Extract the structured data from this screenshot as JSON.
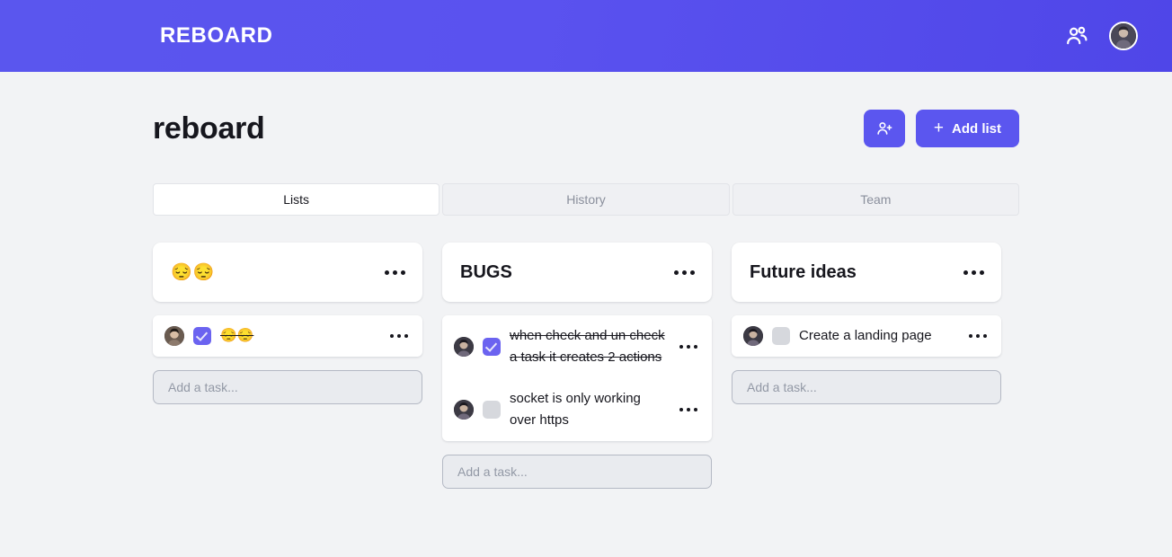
{
  "topbar": {
    "brand": "REBOARD",
    "people_icon": "people-icon",
    "avatar": "user-avatar"
  },
  "header": {
    "board_title": "reboard",
    "invite_button_icon": "person-add-icon",
    "add_list_label": "Add list",
    "add_list_plus": "+"
  },
  "tabs": [
    {
      "label": "Lists",
      "active": true
    },
    {
      "label": "History",
      "active": false
    },
    {
      "label": "Team",
      "active": false
    }
  ],
  "lists": [
    {
      "title": "😔😔",
      "title_is_emoji": true,
      "menu_icon": "more-options-icon",
      "tasks": [
        {
          "text": "😔😔",
          "is_emoji": true,
          "checked": true,
          "avatar": "assignee-avatar",
          "menu_icon": "more-options-icon"
        }
      ],
      "add_task_placeholder": "Add a task..."
    },
    {
      "title": "BUGS",
      "title_is_emoji": false,
      "menu_icon": "more-options-icon",
      "tasks": [
        {
          "text": "when check and un check a task it creates 2 actions",
          "is_emoji": false,
          "checked": true,
          "avatar": "assignee-avatar",
          "menu_icon": "more-options-icon"
        },
        {
          "text": "socket is only working over https",
          "is_emoji": false,
          "checked": false,
          "avatar": "assignee-avatar",
          "menu_icon": "more-options-icon"
        }
      ],
      "add_task_placeholder": "Add a task..."
    },
    {
      "title": "Future ideas",
      "title_is_emoji": false,
      "menu_icon": "more-options-icon",
      "tasks": [
        {
          "text": "Create a landing page",
          "is_emoji": false,
          "checked": false,
          "avatar": "assignee-avatar",
          "menu_icon": "more-options-icon"
        }
      ],
      "add_task_placeholder": "Add a task..."
    }
  ],
  "colors": {
    "brand_purple": "#5b56ef",
    "header_gradient_start": "#5a56ee",
    "header_gradient_end": "#4f46e8",
    "page_background": "#f2f3f5",
    "card_background": "#ffffff",
    "checkbox_checked": "#6b63f0",
    "checkbox_unchecked": "#d6d8dd",
    "tab_inactive_text": "#8a8f9c"
  }
}
